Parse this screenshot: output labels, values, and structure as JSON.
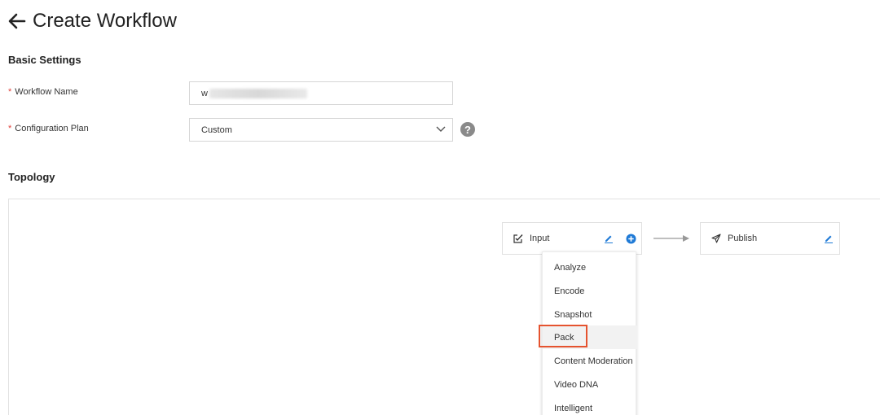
{
  "header": {
    "title": "Create Workflow"
  },
  "basic_settings": {
    "title": "Basic Settings",
    "workflow_name": {
      "label": "Workflow Name",
      "required_mark": "*",
      "value_visible": "w"
    },
    "configuration_plan": {
      "label": "Configuration Plan",
      "required_mark": "*",
      "selected": "Custom",
      "help_symbol": "?"
    }
  },
  "topology": {
    "title": "Topology",
    "nodes": {
      "input": {
        "label": "Input",
        "icon": "checkbox-edit-icon"
      },
      "publish": {
        "label": "Publish",
        "icon": "send-icon"
      }
    },
    "add_menu": {
      "items": [
        "Analyze",
        "Encode",
        "Snapshot",
        "Pack",
        "Content Moderation",
        "Video DNA",
        "Intelligent"
      ],
      "highlighted": "Pack"
    }
  },
  "colors": {
    "accent_blue": "#1f7ad6",
    "highlight_red": "#e5532f",
    "required_red": "#e0403a"
  }
}
